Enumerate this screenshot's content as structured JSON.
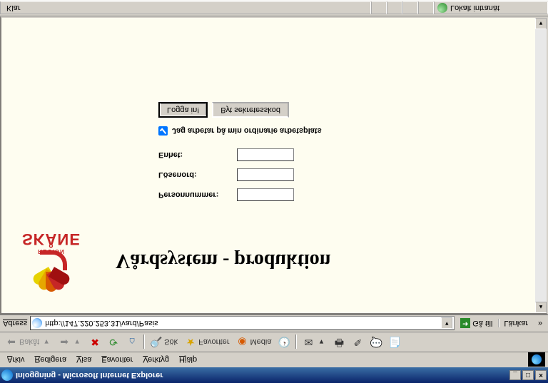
{
  "window": {
    "title": "Inloggning - Microsoft Internet Explorer"
  },
  "menu": {
    "arkiv": "Arkiv",
    "redigera": "Redigera",
    "visa": "Visa",
    "favoriter": "Eavoriter",
    "verktyg": "Verktyg",
    "hjalp": "Hjälp"
  },
  "toolbar": {
    "back": "Bakåt",
    "sok": "Sök",
    "favoriter": "Favoriter",
    "media": "Media"
  },
  "address": {
    "label": "Adress",
    "url": "http://147.220.253.31/vard/Pasis",
    "go": "Gå till",
    "links": "Länkar"
  },
  "page": {
    "logo_region": "REGION",
    "logo_skane": "SKÅNE",
    "heading": "Vårdsystem - produktion",
    "personnummer_label": "Personnummer:",
    "losenord_label": "Lösenord:",
    "enhet_label": "Enhet:",
    "checkbox_label": "Jag arbetar på min ordinarie arbetsplats",
    "login_btn": "Logga in!",
    "change_btn": "Byt sekretesskod"
  },
  "status": {
    "text": "Klar",
    "zone": "Lokalt intranät"
  }
}
